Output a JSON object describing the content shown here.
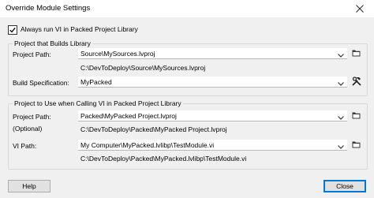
{
  "window": {
    "title": "Override Module Settings"
  },
  "always_run": {
    "label": "Always run VI in Packed Project Library",
    "checked": true
  },
  "builds_group": {
    "title": "Project that Builds Library",
    "project_path_label": "Project Path:",
    "project_path_value": "Source\\MySources.lvproj",
    "project_path_resolved": "C:\\DevToDeploy\\Source\\MySources.lvproj",
    "build_spec_label": "Build Specification:",
    "build_spec_value": "MyPacked"
  },
  "calling_group": {
    "title": "Project to Use when Calling VI in Packed Project Library",
    "project_path_label": "Project Path:",
    "optional_label": "(Optional)",
    "project_path_value": "Packed\\MyPacked Project.lvproj",
    "project_path_resolved": "C:\\DevToDeploy\\Packed\\MyPacked Project.lvproj",
    "vi_path_label": "VI Path:",
    "vi_path_value": "My Computer\\MyPacked.lvlibp\\TestModule.vi",
    "vi_path_resolved": "C:\\DevToDeploy\\Packed\\MyPacked.lvlibp\\TestModule.vi"
  },
  "buttons": {
    "help": "Help",
    "close": "Close"
  },
  "icons": {
    "folder": "folder-icon",
    "tools": "hammer-wrench-icon",
    "dropdown": "chevron-down-icon",
    "close": "close-icon"
  }
}
